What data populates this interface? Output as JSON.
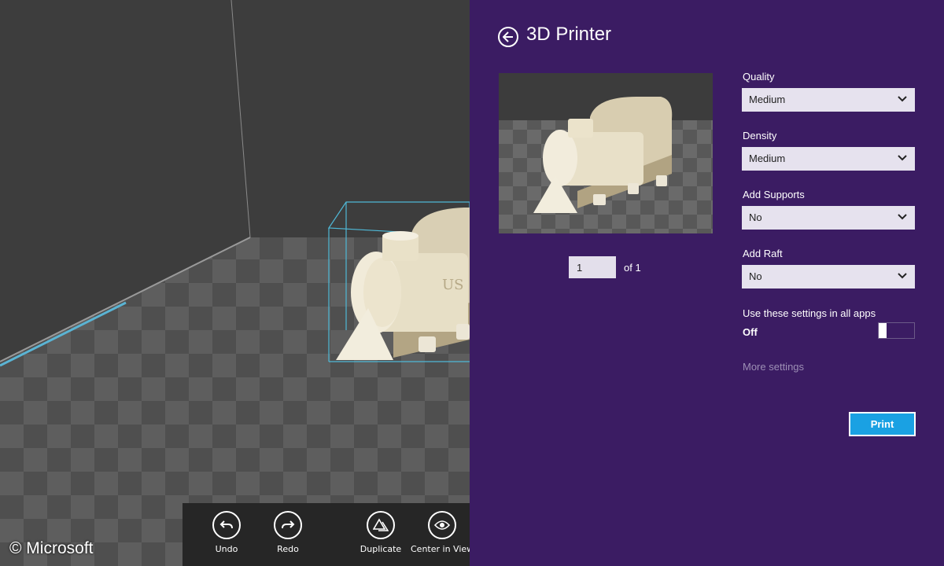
{
  "copyright": "© Microsoft",
  "app_bar": {
    "buttons": [
      {
        "label": "Undo",
        "icon": "undo-icon"
      },
      {
        "label": "Redo",
        "icon": "redo-icon"
      },
      {
        "label": "Duplicate",
        "icon": "duplicate-icon"
      },
      {
        "label": "Center in View",
        "icon": "eye-icon"
      }
    ]
  },
  "panel": {
    "title": "3D Printer",
    "page_number": "1",
    "page_of": "of 1",
    "fields": [
      {
        "label": "Quality",
        "value": "Medium"
      },
      {
        "label": "Density",
        "value": "Medium"
      },
      {
        "label": "Add Supports",
        "value": "No"
      },
      {
        "label": "Add Raft",
        "value": "No"
      }
    ],
    "use_settings_label": "Use these settings in all apps",
    "use_settings_state": "Off",
    "more_settings": "More settings",
    "print_label": "Print"
  },
  "colors": {
    "panel_bg": "#3b1c63",
    "print_button": "#1aa1e3",
    "select_bg": "#e6e2ee",
    "bounding_box": "#4fb8d6"
  }
}
